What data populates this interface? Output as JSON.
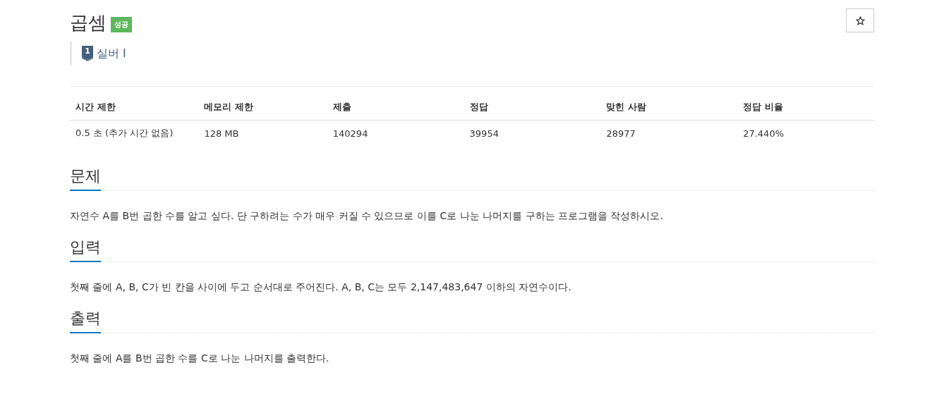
{
  "problem": {
    "title": "곱셈",
    "result_badge": "성공",
    "tier": {
      "number": "1",
      "label": "실버 I"
    },
    "favorite_button": {
      "starred": false
    }
  },
  "info_table": {
    "columns": [
      "시간 제한",
      "메모리 제한",
      "제출",
      "정답",
      "맞힌 사람",
      "정답 비율"
    ],
    "rows": [
      [
        "0.5 초 (추가 시간 없음)",
        "128 MB",
        "140294",
        "39954",
        "28977",
        "27.440%"
      ]
    ]
  },
  "sections": [
    {
      "heading": "문제",
      "body": "자연수 A를 B번 곱한 수를 알고 싶다. 단 구하려는 수가 매우 커질 수 있으므로 이를 C로 나눈 나머지를 구하는 프로그램을 작성하시오."
    },
    {
      "heading": "입력",
      "body": "첫째 줄에 A, B, C가 빈 칸을 사이에 두고 순서대로 주어진다. A, B, C는 모두 2,147,483,647 이하의 자연수이다."
    },
    {
      "heading": "출력",
      "body": "첫째 줄에 A를 B번 곱한 수를 C로 나눈 나머지를 출력한다."
    }
  ]
}
